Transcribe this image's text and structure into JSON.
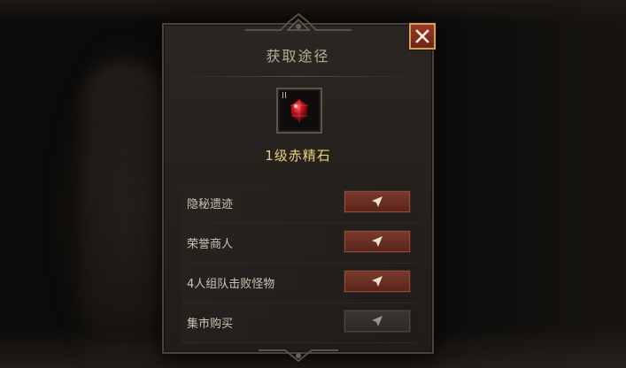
{
  "dialog": {
    "title": "获取途径",
    "item": {
      "tier_label": "II",
      "name": "1级赤精石",
      "icon": "red-gem-icon",
      "gem_color": "#c4141a"
    },
    "sources": [
      {
        "label": "隐秘遗迹",
        "button_icon": "send-arrow-icon",
        "state": "active"
      },
      {
        "label": "荣誉商人",
        "button_icon": "send-arrow-icon",
        "state": "active"
      },
      {
        "label": "4人组队击败怪物",
        "button_icon": "send-arrow-icon",
        "state": "active"
      },
      {
        "label": "集市购买",
        "button_icon": "send-arrow-icon",
        "state": "disabled"
      }
    ],
    "close_icon": "close-icon"
  },
  "colors": {
    "accent_gold": "#e7d07c",
    "button_red": "#7a3a2e",
    "button_gray": "#3a3633",
    "close_red": "#9a3a24"
  }
}
